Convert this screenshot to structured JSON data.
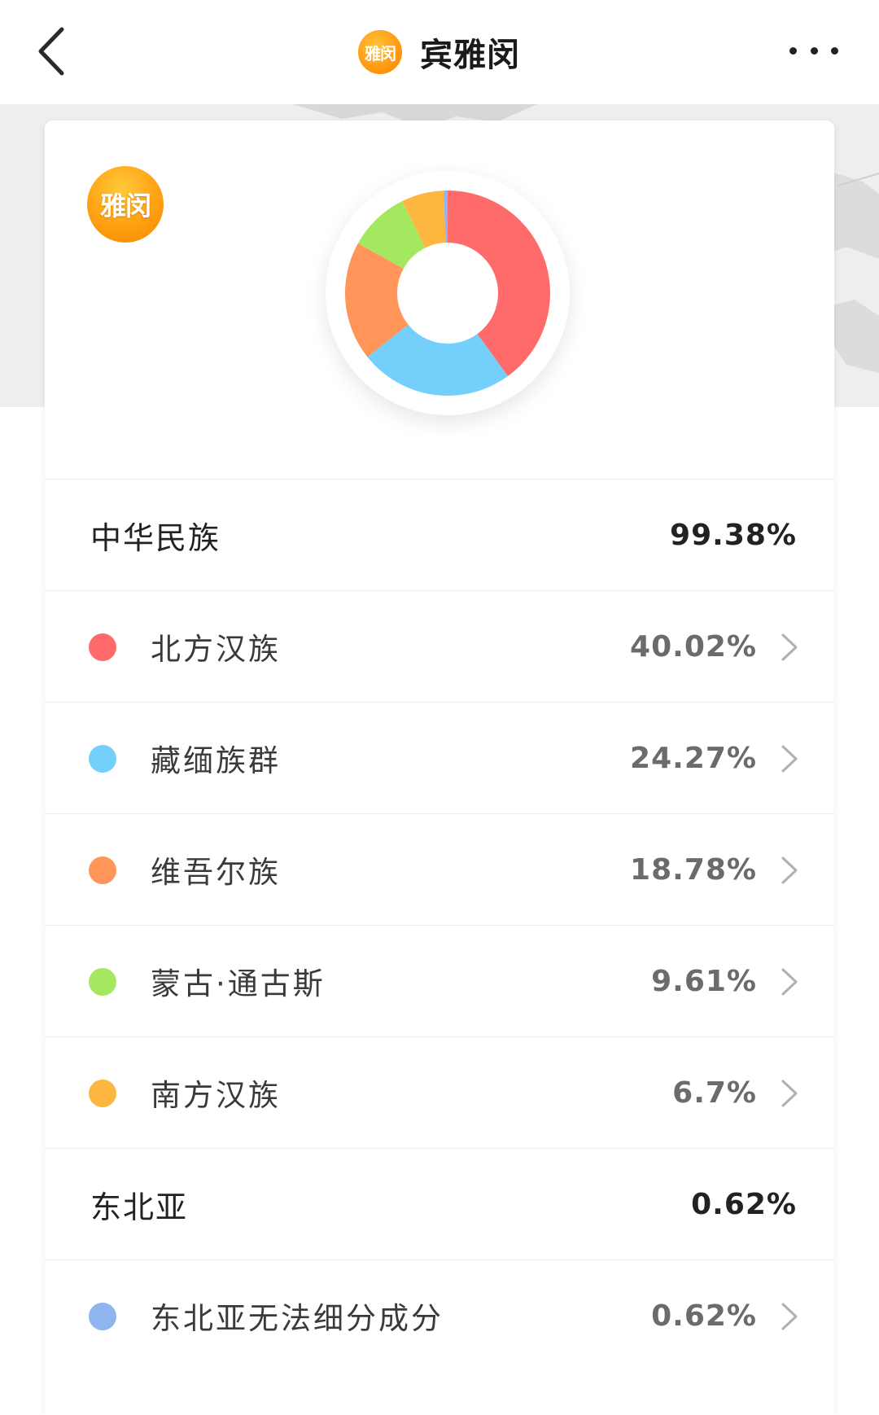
{
  "header": {
    "title": "宾雅闵",
    "avatar_text": "雅闵"
  },
  "card": {
    "avatar_text": "雅闵"
  },
  "groups": [
    {
      "label": "中华民族",
      "value": "99.38%",
      "items": [
        {
          "label": "北方汉族",
          "value": "40.02%",
          "color": "#ff6b6b"
        },
        {
          "label": "藏缅族群",
          "value": "24.27%",
          "color": "#74d0fb"
        },
        {
          "label": "维吾尔族",
          "value": "18.78%",
          "color": "#ff9559"
        },
        {
          "label": "蒙古·通古斯",
          "value": "9.61%",
          "color": "#a3e85f"
        },
        {
          "label": "南方汉族",
          "value": "6.7%",
          "color": "#fdb640"
        }
      ]
    },
    {
      "label": "东北亚",
      "value": "0.62%",
      "items": [
        {
          "label": "东北亚无法细分成分",
          "value": "0.62%",
          "color": "#8fb4ee"
        }
      ]
    }
  ],
  "chart_data": {
    "type": "pie",
    "categories": [
      "北方汉族",
      "藏缅族群",
      "维吾尔族",
      "蒙古·通古斯",
      "南方汉族",
      "东北亚无法细分成分"
    ],
    "values": [
      40.02,
      24.27,
      18.78,
      9.61,
      6.7,
      0.62
    ],
    "colors": [
      "#ff6b6b",
      "#74d0fb",
      "#ff9559",
      "#a3e85f",
      "#fdb640",
      "#8fb4ee"
    ],
    "donut": true
  }
}
